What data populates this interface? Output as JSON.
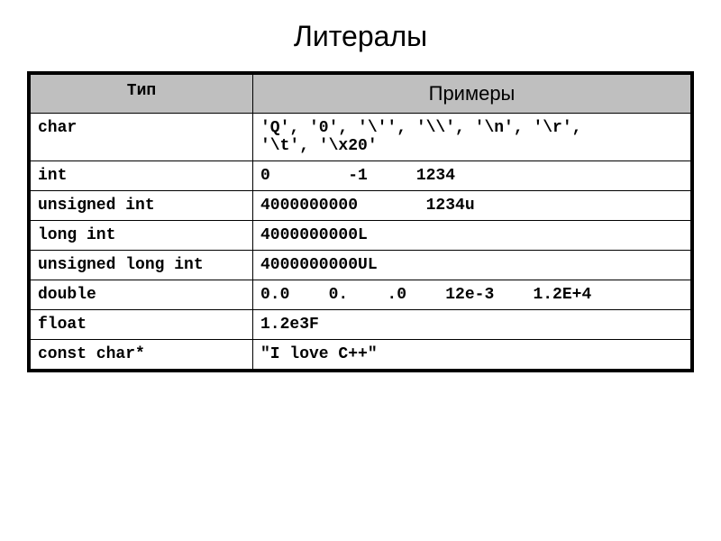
{
  "title": "Литералы",
  "headers": {
    "type": "Тип",
    "examples": "Примеры"
  },
  "rows": [
    {
      "type": "char",
      "example": "'Q', '0', '\\'', '\\\\', '\\n', '\\r',\n'\\t', '\\x20'"
    },
    {
      "type": "int",
      "example": "0        -1     1234"
    },
    {
      "type": "unsigned int",
      "example": "4000000000       1234u"
    },
    {
      "type": "long int",
      "example": "4000000000L"
    },
    {
      "type": "unsigned long int",
      "example": "4000000000UL"
    },
    {
      "type": "double",
      "example": "0.0    0.    .0    12e-3    1.2E+4"
    },
    {
      "type": "float",
      "example": "1.2e3F"
    },
    {
      "type": "const char*",
      "example": "\"I love C++\""
    }
  ]
}
